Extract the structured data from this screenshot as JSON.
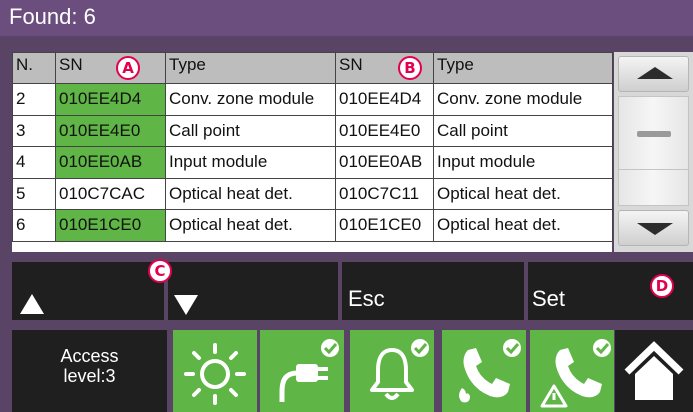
{
  "header": {
    "title": "Found: 6"
  },
  "table": {
    "columns": [
      "N.",
      "SN",
      "Type",
      "SN",
      "Type"
    ],
    "rows": [
      {
        "n": "2",
        "sn_a": "010EE4D4",
        "type_a": "Conv. zone module",
        "sn_b": "010EE4D4",
        "type_b": "Conv. zone module",
        "match": true
      },
      {
        "n": "3",
        "sn_a": "010EE4E0",
        "type_a": "Call point",
        "sn_b": "010EE4E0",
        "type_b": "Call point",
        "match": true
      },
      {
        "n": "4",
        "sn_a": "010EE0AB",
        "type_a": "Input module",
        "sn_b": "010EE0AB",
        "type_b": "Input module",
        "match": true
      },
      {
        "n": "5",
        "sn_a": "010C7CAC",
        "type_a": "Optical heat det.",
        "sn_b": "010C7C11",
        "type_b": "Optical heat det.",
        "match": false
      },
      {
        "n": "6",
        "sn_a": "010E1CE0",
        "type_a": "Optical heat det.",
        "sn_b": "010E1CE0",
        "type_b": "Optical heat det.",
        "match": true
      }
    ]
  },
  "markers": {
    "a": "A",
    "b": "B",
    "c": "C",
    "d": "D"
  },
  "buttons": {
    "esc": "Esc",
    "set": "Set"
  },
  "status": {
    "access_line1": "Access",
    "access_line2": "level:3"
  },
  "colors": {
    "match_green": "#5fb545",
    "title_purple": "#6b4e7d",
    "marker_pink": "#e3004f"
  },
  "icons": [
    "sun-icon",
    "power-plug-icon",
    "bell-icon",
    "phone-fire-icon",
    "phone-warning-icon",
    "home-icon"
  ]
}
